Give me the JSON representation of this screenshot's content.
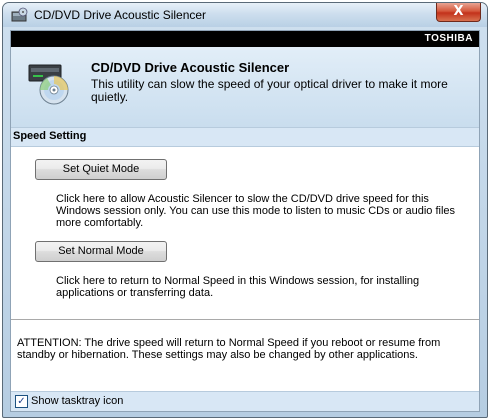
{
  "window": {
    "title": "CD/DVD Drive Acoustic Silencer",
    "close_glyph": "X",
    "app_icon": "cd-drive-icon"
  },
  "brand": "TOSHIBA",
  "header": {
    "title": "CD/DVD Drive Acoustic Silencer",
    "description": "This utility can slow  the speed of  your optical driver to make it more quietly.",
    "icon": "cd-disc-icon"
  },
  "section": {
    "title": "Speed Setting"
  },
  "quiet": {
    "button_label": "Set Quiet Mode",
    "description": "Click here to allow Acoustic Silencer to slow the CD/DVD drive speed for this Windows session only. You can use this mode to listen to music CDs or audio files more comfortably."
  },
  "normal": {
    "button_label": "Set Normal Mode",
    "description": "Click here to return to Normal Speed in this Windows session, for installing applications or transferring data."
  },
  "attention": "ATTENTION: The drive speed will return to Normal Speed if you reboot or resume from standby or hibernation. These settings may also be changed by other applications.",
  "footer": {
    "checkbox_label": "Show tasktray icon",
    "checked": true,
    "check_glyph": "✓"
  },
  "colors": {
    "brand_bar": "#000000",
    "header_bg": "#d6e6f4",
    "close_button": "#c9452a"
  }
}
